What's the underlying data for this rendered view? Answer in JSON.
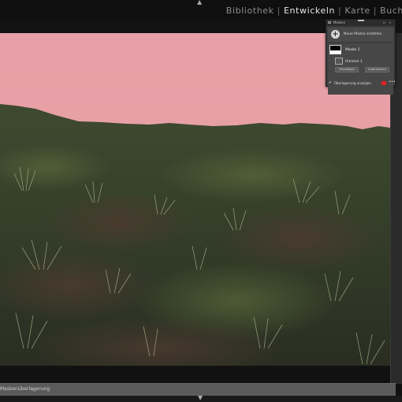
{
  "top_nav": {
    "modules": [
      {
        "label": "Bibliothek",
        "active": false
      },
      {
        "label": "Entwickeln",
        "active": true
      },
      {
        "label": "Karte",
        "active": false
      },
      {
        "label": "Buch",
        "active": false
      }
    ]
  },
  "mask_panel": {
    "title": "Masken",
    "new_mask_label": "Neue Maske erstellen",
    "masks": [
      {
        "name": "Maske 1",
        "components": [
          "Himmel 1"
        ]
      }
    ],
    "add_button": "Hinzufügen",
    "subtract_button": "Subtrahieren",
    "show_overlay_label": "Überlagerung anzeigen",
    "show_overlay_checked": true,
    "overlay_color": "#e02020"
  },
  "toolbar": {
    "overlay_label": "Maskenüberlagerung"
  },
  "photo": {
    "sky_colors": [
      "#e8a0a6",
      "#e4a1a3",
      "#caa09a"
    ],
    "ground_color": "#3c4a2a"
  }
}
